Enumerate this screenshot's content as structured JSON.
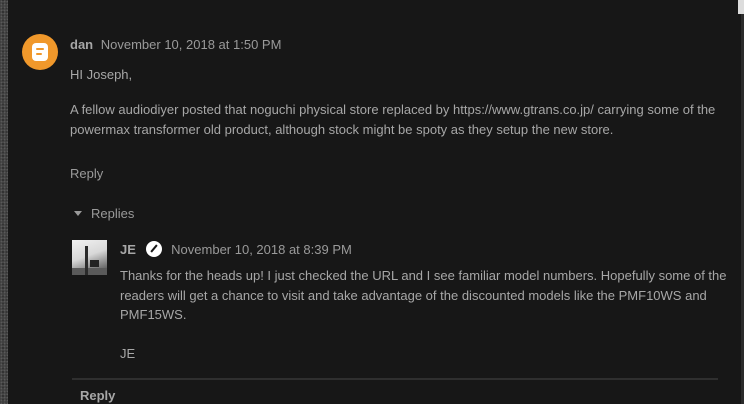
{
  "comment": {
    "author": "dan",
    "timestamp": "November 10, 2018 at 1:50 PM",
    "greeting": "HI Joseph,",
    "body": "A fellow audiodiyer posted that noguchi physical store replaced by https://www.gtrans.co.jp/ carrying some of the powermax transformer old product, although stock might be spoty as they setup the new store.",
    "reply_label": "Reply",
    "avatar_icon": "blogger-icon"
  },
  "replies": {
    "toggle_label": "Replies",
    "items": [
      {
        "author": "JE",
        "timestamp": "November 10, 2018 at 8:39 PM",
        "badge_icon": "pencil-icon",
        "body": "Thanks for the heads up! I just checked the URL and I see familiar model numbers. Hopefully some of the readers will get a chance to visit and take advantage of the discounted models like the PMF10WS and PMF15WS.",
        "signature": "JE"
      }
    ],
    "bottom_reply_label": "Reply"
  },
  "colors": {
    "background": "#171717",
    "text": "#a7a7a7",
    "blogger_orange": "#f0982b"
  }
}
